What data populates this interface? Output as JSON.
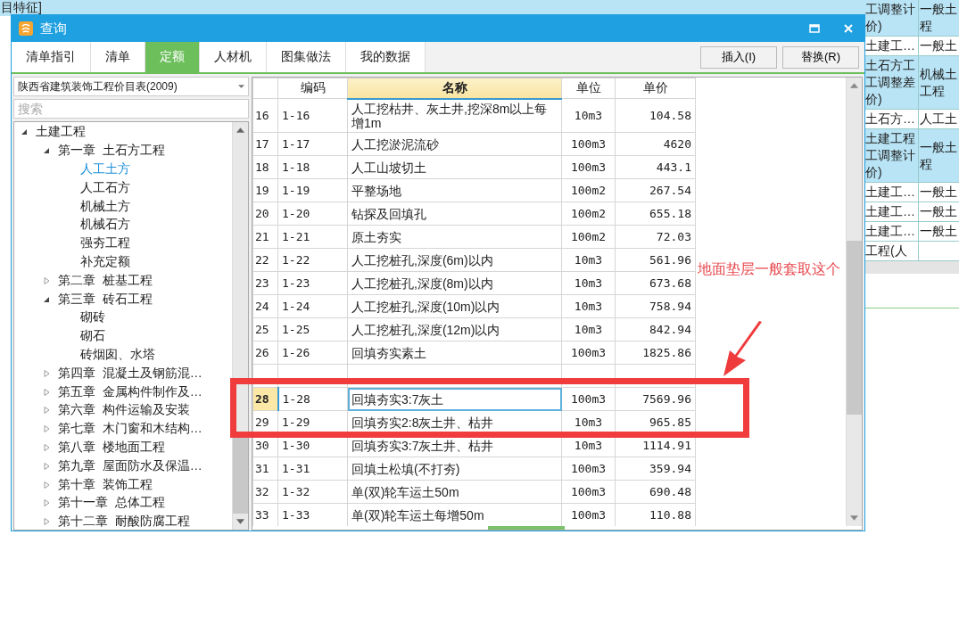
{
  "background_sheet": {
    "top_row": "目特征]",
    "right_rows": [
      {
        "column_a": "工调整计价)",
        "column_b": "一般土程",
        "shaded": true
      },
      {
        "column_a": "土建工…",
        "column_b": "一般土",
        "shaded": false
      },
      {
        "column_a": "土石方工工调整差价)",
        "column_b": "机械土工程",
        "shaded": true
      },
      {
        "column_a": "土石方…",
        "column_b": "人工土",
        "shaded": false
      },
      {
        "column_a": "土建工程工调整计价)",
        "column_b": "一般土程",
        "shaded": true
      },
      {
        "column_a": "土建工…",
        "column_b": "一般土",
        "shaded": false
      },
      {
        "column_a": "土建工…",
        "column_b": "一般土",
        "shaded": false
      },
      {
        "column_a": "土建工…",
        "column_b": "一般土",
        "shaded": false
      },
      {
        "column_a": "工程(人",
        "shaded": false
      }
    ]
  },
  "dialog": {
    "title": "查询",
    "tabs": [
      {
        "label": "清单指引",
        "selected": false
      },
      {
        "label": "清单",
        "selected": false
      },
      {
        "label": "定额",
        "selected": true
      },
      {
        "label": "人材机",
        "selected": false
      },
      {
        "label": "图集做法",
        "selected": false
      },
      {
        "label": "我的数据",
        "selected": false
      }
    ],
    "buttons": [
      "插入(I)",
      "替换(R)"
    ],
    "library": "陕西省建筑装饰工程价目表(2009)",
    "search": {
      "placeholder": "搜索"
    },
    "tree": [
      {
        "label": "土建工程",
        "selected": false,
        "expanded": true,
        "children": [
          {
            "label": "第一章  土石方工程",
            "selected": false,
            "expanded": true,
            "children": [
              {
                "label": "人工土方",
                "selected": true
              },
              {
                "label": "人工石方",
                "selected": false
              },
              {
                "label": "机械土方",
                "selected": false
              },
              {
                "label": "机械石方",
                "selected": false
              },
              {
                "label": "强夯工程",
                "selected": false
              },
              {
                "label": "补充定额",
                "selected": false
              }
            ]
          },
          {
            "label": "第二章  桩基工程",
            "selected": false,
            "expanded": false
          },
          {
            "label": "第三章  砖石工程",
            "selected": false,
            "expanded": true,
            "children": [
              {
                "label": "砌砖",
                "selected": false
              },
              {
                "label": "砌石",
                "selected": false
              },
              {
                "label": "砖烟囱、水塔",
                "selected": false
              }
            ]
          },
          {
            "label": "第四章  混凝土及钢筋混…",
            "selected": false,
            "expanded": false
          },
          {
            "label": "第五章  金属构件制作及…",
            "selected": false,
            "expanded": false
          },
          {
            "label": "第六章  构件运输及安装",
            "selected": false,
            "expanded": false
          },
          {
            "label": "第七章  木门窗和木结构…",
            "selected": false,
            "expanded": false
          },
          {
            "label": "第八章  楼地面工程",
            "selected": false,
            "expanded": false
          },
          {
            "label": "第九章  屋面防水及保温…",
            "selected": false,
            "expanded": false
          },
          {
            "label": "第十章  装饰工程",
            "selected": false,
            "expanded": false
          },
          {
            "label": "第十一章  总体工程",
            "selected": false,
            "expanded": false
          },
          {
            "label": "第十二章  耐酸防腐工程",
            "selected": false,
            "expanded": false
          }
        ]
      }
    ],
    "table": {
      "columns": [
        {
          "label": "编码",
          "active": false
        },
        {
          "label": "名称",
          "active": true
        },
        {
          "label": "单位",
          "active": false
        },
        {
          "label": "单价",
          "active": false
        }
      ],
      "rows": [
        {
          "index": "16",
          "code": "1-16",
          "name": "人工挖枯井、灰土井,挖深8m以上每增1m",
          "unit": "10m3",
          "price": "104.58",
          "selected": false
        },
        {
          "index": "17",
          "code": "1-17",
          "name": "人工挖淤泥流砂",
          "unit": "100m3",
          "price": "4620",
          "selected": false
        },
        {
          "index": "18",
          "code": "1-18",
          "name": "人工山坡切土",
          "unit": "100m3",
          "price": "443.1",
          "selected": false
        },
        {
          "index": "19",
          "code": "1-19",
          "name": "平整场地",
          "unit": "100m2",
          "price": "267.54",
          "selected": false
        },
        {
          "index": "20",
          "code": "1-20",
          "name": "钻探及回填孔",
          "unit": "100m2",
          "price": "655.18",
          "selected": false
        },
        {
          "index": "21",
          "code": "1-21",
          "name": "原土夯实",
          "unit": "100m2",
          "price": "72.03",
          "selected": false
        },
        {
          "index": "22",
          "code": "1-22",
          "name": "人工挖桩孔,深度(6m)以内",
          "unit": "10m3",
          "price": "561.96",
          "selected": false
        },
        {
          "index": "23",
          "code": "1-23",
          "name": "人工挖桩孔,深度(8m)以内",
          "unit": "10m3",
          "price": "673.68",
          "selected": false
        },
        {
          "index": "24",
          "code": "1-24",
          "name": "人工挖桩孔,深度(10m)以内",
          "unit": "10m3",
          "price": "758.94",
          "selected": false
        },
        {
          "index": "25",
          "code": "1-25",
          "name": "人工挖桩孔,深度(12m)以内",
          "unit": "10m3",
          "price": "842.94",
          "selected": false
        },
        {
          "index": "26",
          "code": "1-26",
          "name": "回填夯实素土",
          "unit": "100m3",
          "price": "1825.86",
          "selected": false
        },
        {
          "covered": true,
          "selected": false
        },
        {
          "index": "28",
          "code": "1-28",
          "name": "回填夯实3:7灰土",
          "unit": "100m3",
          "price": "7569.96",
          "selected": true
        },
        {
          "index": "29",
          "code": "1-29",
          "name": "回填夯实2:8灰土井、枯井",
          "unit": "10m3",
          "price": "965.85",
          "selected": false
        },
        {
          "index": "30",
          "code": "1-30",
          "name": "回填夯实3:7灰土井、枯井",
          "unit": "10m3",
          "price": "1114.91",
          "selected": false
        },
        {
          "index": "31",
          "code": "1-31",
          "name": "回填土松填(不打夯)",
          "unit": "100m3",
          "price": "359.94",
          "selected": false
        },
        {
          "index": "32",
          "code": "1-32",
          "name": "单(双)轮车运土50m",
          "unit": "100m3",
          "price": "690.48",
          "selected": false
        },
        {
          "index": "33",
          "code": "1-33",
          "name": "单(双)轮车运土每增50m",
          "unit": "100m3",
          "price": "110.88",
          "selected": false
        }
      ]
    }
  },
  "annotation": {
    "note": "地面垫层一般套取这个"
  }
}
